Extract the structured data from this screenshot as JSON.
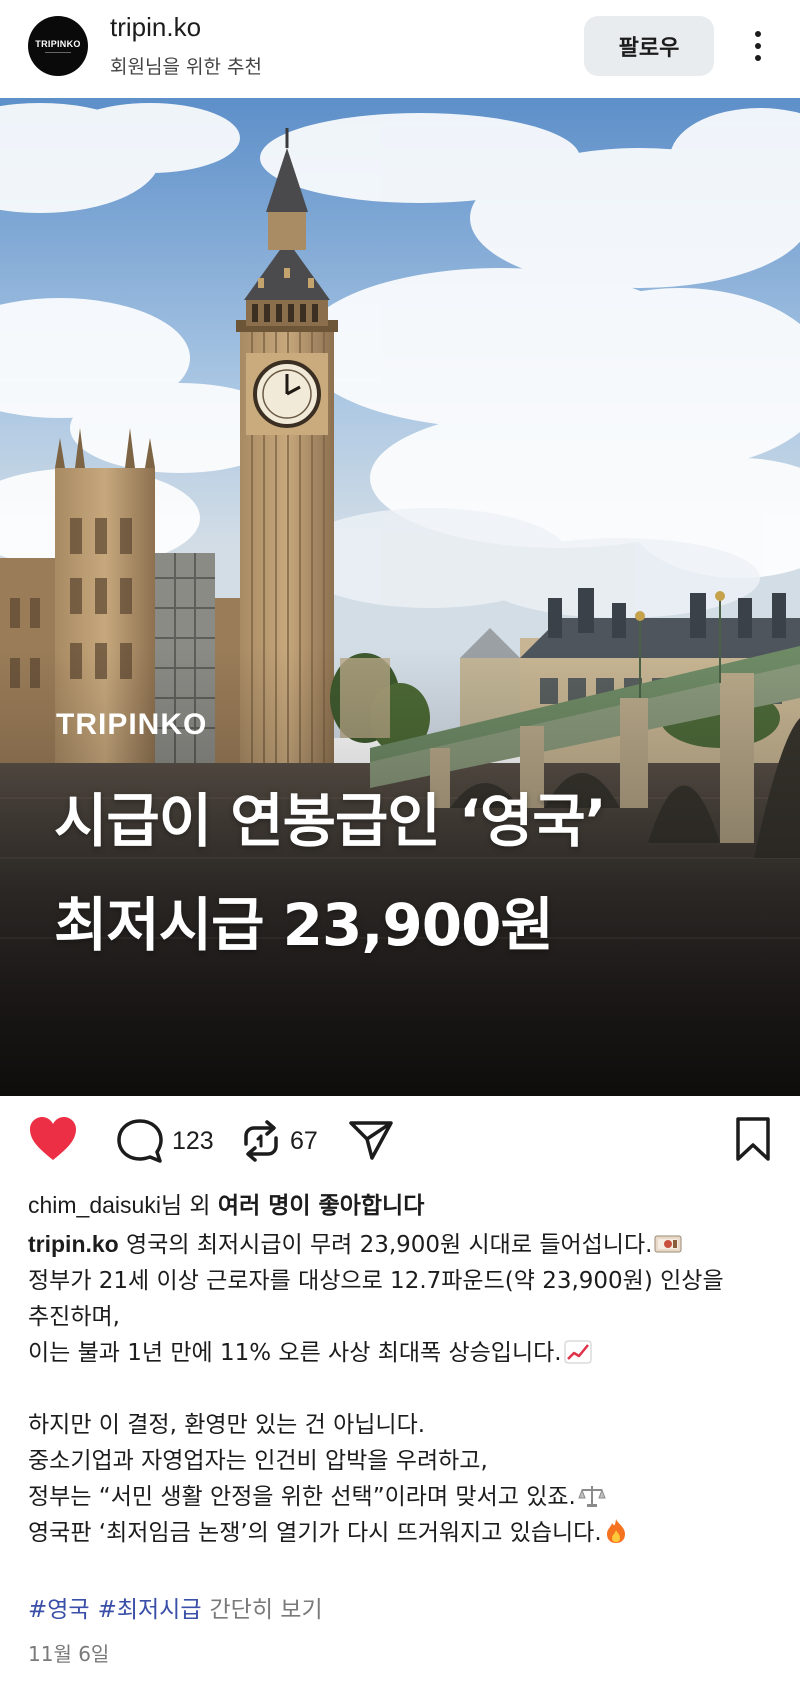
{
  "header": {
    "avatar_text": "TRIPINKO",
    "account_name": "tripin.ko",
    "subtitle": "회원님을 위한 추천",
    "follow_label": "팔로우",
    "more_icon": "more-vertical-icon"
  },
  "post": {
    "brand": "TRIPINKO",
    "headline_line1": "시급이 연봉급인 ‘영국’",
    "headline_line2": "최저시급 23,900원"
  },
  "actions": {
    "like_icon": "heart-filled-icon",
    "like_color": "#ed2f45",
    "comment_icon": "comment-icon",
    "comment_count": "123",
    "repost_icon": "repost-icon",
    "repost_count": "67",
    "share_icon": "send-icon",
    "save_icon": "bookmark-icon"
  },
  "likes": {
    "user": "chim_daisuki",
    "suffix_normal": "님 외 ",
    "suffix_bold": "여러 명이 좋아합니다"
  },
  "caption": {
    "user": "tripin.ko",
    "line1_text": " 영국의 최저시급이 무려 23,900원 시대로 들어섭니다.",
    "line2": "정부가 21세 이상 근로자를 대상으로 12.7파운드(약 23,900원) 인상을",
    "line3": "추진하며,",
    "line4": "이는 불과 1년 만에 11% 오른 사상 최대폭 상승입니다.",
    "line5": "하지만 이 결정, 환영만 있는 건 아닙니다.",
    "line6": "중소기업과 자영업자는 인건비 압박을 우려하고,",
    "line7": "정부는 “서민 생활 안정을 위한 선택”이라며 맞서고 있죠.",
    "line8": "영국판 ‘최저임금 논쟁’의 열기가 다시 뜨거워지고 있습니다.",
    "emoji_money": "money-emoji-icon",
    "emoji_chart": "chart-up-emoji-icon",
    "emoji_scale": "balance-scale-emoji-icon",
    "emoji_fire": "fire-emoji-icon"
  },
  "tags": {
    "tag1": "#영국",
    "tag2": "#최저시급",
    "more": "간단히 보기"
  },
  "date": "11월 6일"
}
